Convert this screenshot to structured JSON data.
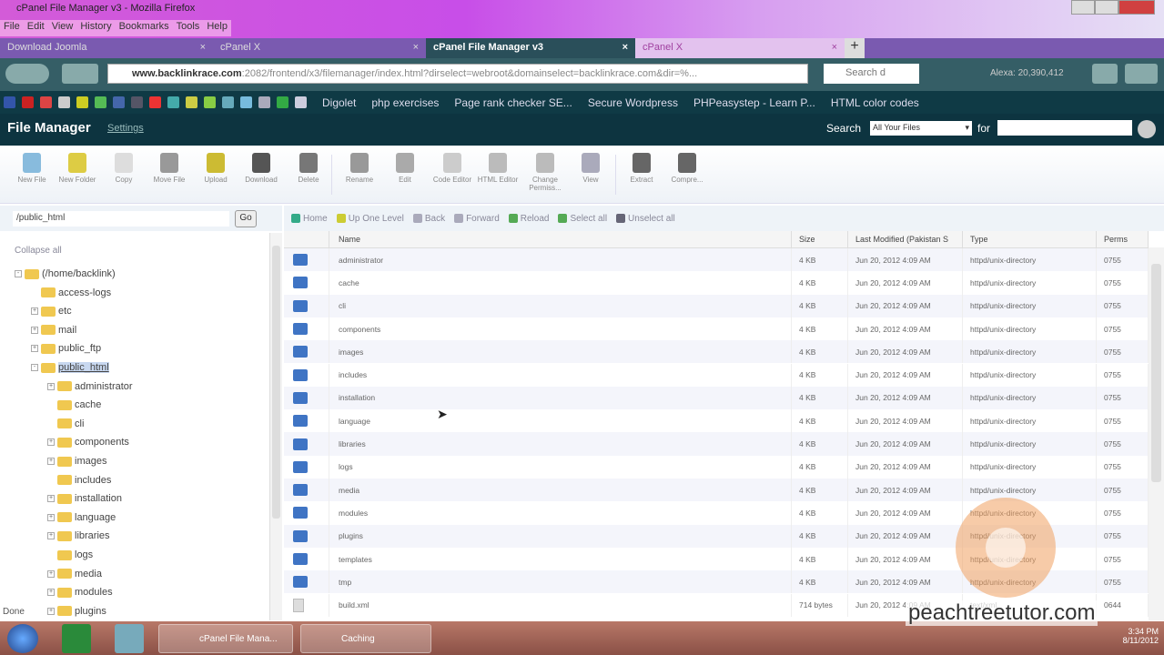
{
  "window": {
    "title": "cPanel File Manager v3 - Mozilla Firefox",
    "menu": [
      "File",
      "Edit",
      "View",
      "History",
      "Bookmarks",
      "Tools",
      "Help"
    ]
  },
  "tabs": [
    {
      "label": "Download Joomla"
    },
    {
      "label": "cPanel X"
    },
    {
      "label": "cPanel File Manager v3"
    },
    {
      "label": "cPanel X"
    }
  ],
  "nav": {
    "url_domain": "www.backlinkrace.com",
    "url_rest": ":2082/frontend/x3/filemanager/index.html?dirselect=webroot&domainselect=backlinkrace.com&dir=%...",
    "search_placeholder": "Search d",
    "alexa": "Alexa: 20,390,412"
  },
  "bookmarks": [
    "Digolet",
    "php exercises",
    "Page rank checker SE...",
    "Secure Wordpress",
    "PHPeasystep - Learn P...",
    "HTML color codes"
  ],
  "header": {
    "title": "File Manager",
    "settings": "Settings",
    "search_label": "Search",
    "search_scope": "All Your Files",
    "for_label": "for"
  },
  "toolbar": [
    "New File",
    "New Folder",
    "Copy",
    "Move File",
    "Upload",
    "Download",
    "Delete",
    "Rename",
    "Edit",
    "Code Editor",
    "HTML Editor",
    "Change Permiss...",
    "View",
    "Extract",
    "Compre..."
  ],
  "pathbar": {
    "value": "/public_html",
    "go": "Go"
  },
  "navlinks": [
    "Home",
    "Up One Level",
    "Back",
    "Forward",
    "Reload",
    "Select all",
    "Unselect all"
  ],
  "tree": {
    "collapse": "Collapse all",
    "nodes": [
      {
        "label": "(/home/backlink)",
        "depth": 0,
        "pm": "-"
      },
      {
        "label": "access-logs",
        "depth": 1,
        "pm": ""
      },
      {
        "label": "etc",
        "depth": 1,
        "pm": "+"
      },
      {
        "label": "mail",
        "depth": 1,
        "pm": "+"
      },
      {
        "label": "public_ftp",
        "depth": 1,
        "pm": "+"
      },
      {
        "label": "public_html",
        "depth": 1,
        "pm": "-",
        "selected": true
      },
      {
        "label": "administrator",
        "depth": 2,
        "pm": "+"
      },
      {
        "label": "cache",
        "depth": 2,
        "pm": ""
      },
      {
        "label": "cli",
        "depth": 2,
        "pm": ""
      },
      {
        "label": "components",
        "depth": 2,
        "pm": "+"
      },
      {
        "label": "images",
        "depth": 2,
        "pm": "+"
      },
      {
        "label": "includes",
        "depth": 2,
        "pm": ""
      },
      {
        "label": "installation",
        "depth": 2,
        "pm": "+"
      },
      {
        "label": "language",
        "depth": 2,
        "pm": "+"
      },
      {
        "label": "libraries",
        "depth": 2,
        "pm": "+"
      },
      {
        "label": "logs",
        "depth": 2,
        "pm": ""
      },
      {
        "label": "media",
        "depth": 2,
        "pm": "+"
      },
      {
        "label": "modules",
        "depth": 2,
        "pm": "+"
      },
      {
        "label": "plugins",
        "depth": 2,
        "pm": "+"
      }
    ]
  },
  "columns": [
    "Name",
    "Size",
    "Last Modified (Pakistan S",
    "Type",
    "Perms"
  ],
  "files": [
    {
      "name": "administrator",
      "size": "4 KB",
      "modified": "Jun 20, 2012 4:09 AM",
      "type": "httpd/unix-directory",
      "perms": "0755",
      "kind": "folder"
    },
    {
      "name": "cache",
      "size": "4 KB",
      "modified": "Jun 20, 2012 4:09 AM",
      "type": "httpd/unix-directory",
      "perms": "0755",
      "kind": "folder"
    },
    {
      "name": "cli",
      "size": "4 KB",
      "modified": "Jun 20, 2012 4:09 AM",
      "type": "httpd/unix-directory",
      "perms": "0755",
      "kind": "folder"
    },
    {
      "name": "components",
      "size": "4 KB",
      "modified": "Jun 20, 2012 4:09 AM",
      "type": "httpd/unix-directory",
      "perms": "0755",
      "kind": "folder"
    },
    {
      "name": "images",
      "size": "4 KB",
      "modified": "Jun 20, 2012 4:09 AM",
      "type": "httpd/unix-directory",
      "perms": "0755",
      "kind": "folder"
    },
    {
      "name": "includes",
      "size": "4 KB",
      "modified": "Jun 20, 2012 4:09 AM",
      "type": "httpd/unix-directory",
      "perms": "0755",
      "kind": "folder"
    },
    {
      "name": "installation",
      "size": "4 KB",
      "modified": "Jun 20, 2012 4:09 AM",
      "type": "httpd/unix-directory",
      "perms": "0755",
      "kind": "folder"
    },
    {
      "name": "language",
      "size": "4 KB",
      "modified": "Jun 20, 2012 4:09 AM",
      "type": "httpd/unix-directory",
      "perms": "0755",
      "kind": "folder"
    },
    {
      "name": "libraries",
      "size": "4 KB",
      "modified": "Jun 20, 2012 4:09 AM",
      "type": "httpd/unix-directory",
      "perms": "0755",
      "kind": "folder"
    },
    {
      "name": "logs",
      "size": "4 KB",
      "modified": "Jun 20, 2012 4:09 AM",
      "type": "httpd/unix-directory",
      "perms": "0755",
      "kind": "folder"
    },
    {
      "name": "media",
      "size": "4 KB",
      "modified": "Jun 20, 2012 4:09 AM",
      "type": "httpd/unix-directory",
      "perms": "0755",
      "kind": "folder"
    },
    {
      "name": "modules",
      "size": "4 KB",
      "modified": "Jun 20, 2012 4:09 AM",
      "type": "httpd/unix-directory",
      "perms": "0755",
      "kind": "folder"
    },
    {
      "name": "plugins",
      "size": "4 KB",
      "modified": "Jun 20, 2012 4:09 AM",
      "type": "httpd/unix-directory",
      "perms": "0755",
      "kind": "folder"
    },
    {
      "name": "templates",
      "size": "4 KB",
      "modified": "Jun 20, 2012 4:09 AM",
      "type": "httpd/unix-directory",
      "perms": "0755",
      "kind": "folder"
    },
    {
      "name": "tmp",
      "size": "4 KB",
      "modified": "Jun 20, 2012 4:09 AM",
      "type": "httpd/unix-directory",
      "perms": "0755",
      "kind": "folder"
    },
    {
      "name": "build.xml",
      "size": "714 bytes",
      "modified": "Jun 20, 2012 4:09 AM",
      "type": "text/xml",
      "perms": "0644",
      "kind": "file"
    }
  ],
  "status": "Done",
  "taskbar": {
    "apps": [
      "cPanel File Mana...",
      "Caching"
    ],
    "time": "3:34 PM",
    "date": "8/11/2012"
  },
  "watermark": "peachtreetutor.com"
}
